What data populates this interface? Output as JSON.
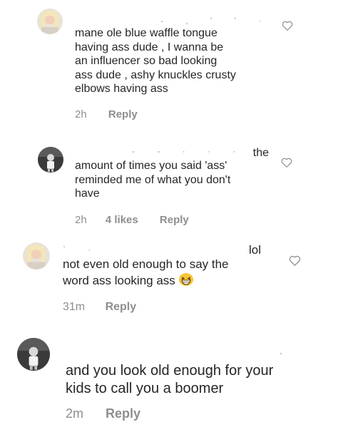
{
  "comments": [
    {
      "text_lines": [
        "mane ole blue waffle tongue",
        "having ass dude , I wanna be",
        "an influencer so bad looking",
        "ass dude , ashy knuckles crusty",
        "elbows having ass"
      ],
      "time": "2h",
      "reply_label": "Reply"
    },
    {
      "first_line_tail": "the",
      "text_lines": [
        "amount of times you said 'ass'",
        "reminded me of what you don't",
        "have"
      ],
      "time": "2h",
      "likes": "4 likes",
      "reply_label": "Reply"
    },
    {
      "first_line_tail": "lol",
      "text_lines": [
        "not even old enough to say the",
        "word ass looking ass"
      ],
      "emoji": "grinning-squinting-face",
      "time": "31m",
      "reply_label": "Reply"
    },
    {
      "text_lines": [
        "and you look old enough for your",
        "kids to call you a boomer"
      ],
      "time": "2m",
      "reply_label": "Reply"
    }
  ],
  "icons": {
    "like": "heart-outline-icon"
  },
  "colors": {
    "text": "#262626",
    "meta": "#8e8e8e"
  }
}
